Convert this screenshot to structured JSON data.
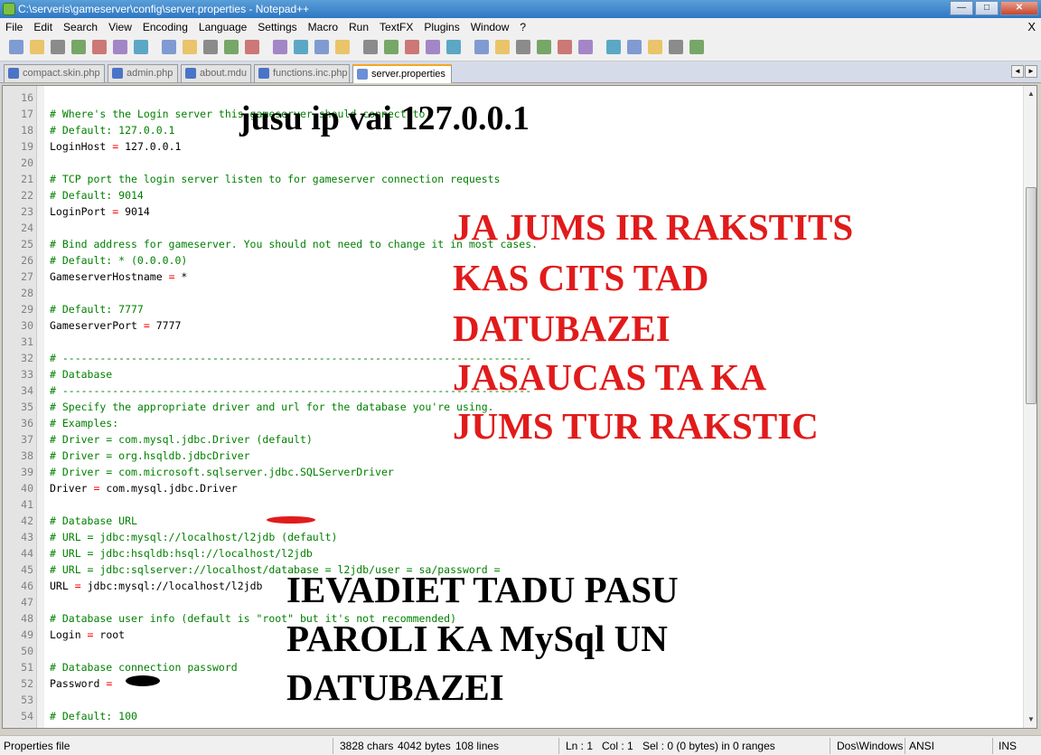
{
  "window": {
    "title": "C:\\serveris\\gameserver\\config\\server.properties - Notepad++"
  },
  "menu": [
    "File",
    "Edit",
    "Search",
    "View",
    "Encoding",
    "Language",
    "Settings",
    "Macro",
    "Run",
    "TextFX",
    "Plugins",
    "Window",
    "?"
  ],
  "menu_close": "X",
  "tabs": [
    {
      "label": "compact.skin.php",
      "active": false
    },
    {
      "label": "admin.php",
      "active": false
    },
    {
      "label": "about.mdu",
      "active": false
    },
    {
      "label": "functions.inc.php",
      "active": false
    },
    {
      "label": "server.properties",
      "active": true
    }
  ],
  "toolbar_icons": [
    "new-icon",
    "open-icon",
    "save-icon",
    "save-all-icon",
    "close-icon",
    "close-all-icon",
    "print-icon",
    "cut-icon",
    "copy-icon",
    "paste-icon",
    "undo-icon",
    "redo-icon",
    "find-icon",
    "replace-icon",
    "zoom-in-icon",
    "zoom-out-icon",
    "sync-v-icon",
    "sync-h-icon",
    "wrap-icon",
    "show-all-icon",
    "indent-guide-icon",
    "record-icon",
    "stop-icon",
    "play-icon",
    "play-multi-icon",
    "save-macro-icon",
    "trim-icon",
    "up-icon",
    "down-icon",
    "sort-icon",
    "folder-icon",
    "spell-icon"
  ],
  "lines": [
    {
      "n": "16",
      "t": "",
      "c": false
    },
    {
      "n": "17",
      "t": "# Where's the Login server this gameserver should connect to",
      "c": true
    },
    {
      "n": "18",
      "t": "# Default: 127.0.0.1",
      "c": true
    },
    {
      "n": "19",
      "t": "LoginHost = 127.0.0.1",
      "c": false
    },
    {
      "n": "20",
      "t": "",
      "c": false
    },
    {
      "n": "21",
      "t": "# TCP port the login server listen to for gameserver connection requests",
      "c": true
    },
    {
      "n": "22",
      "t": "# Default: 9014",
      "c": true
    },
    {
      "n": "23",
      "t": "LoginPort = 9014",
      "c": false
    },
    {
      "n": "24",
      "t": "",
      "c": false
    },
    {
      "n": "25",
      "t": "# Bind address for gameserver. You should not need to change it in most cases.",
      "c": true
    },
    {
      "n": "26",
      "t": "# Default: * (0.0.0.0)",
      "c": true
    },
    {
      "n": "27",
      "t": "GameserverHostname = *",
      "c": false
    },
    {
      "n": "28",
      "t": "",
      "c": false
    },
    {
      "n": "29",
      "t": "# Default: 7777",
      "c": true
    },
    {
      "n": "30",
      "t": "GameserverPort = 7777",
      "c": false
    },
    {
      "n": "31",
      "t": "",
      "c": false
    },
    {
      "n": "32",
      "t": "# ---------------------------------------------------------------------------",
      "c": true
    },
    {
      "n": "33",
      "t": "# Database",
      "c": true
    },
    {
      "n": "34",
      "t": "# ---------------------------------------------------------------------------",
      "c": true
    },
    {
      "n": "35",
      "t": "# Specify the appropriate driver and url for the database you're using.",
      "c": true
    },
    {
      "n": "36",
      "t": "# Examples:",
      "c": true
    },
    {
      "n": "37",
      "t": "# Driver = com.mysql.jdbc.Driver (default)",
      "c": true
    },
    {
      "n": "38",
      "t": "# Driver = org.hsqldb.jdbcDriver",
      "c": true
    },
    {
      "n": "39",
      "t": "# Driver = com.microsoft.sqlserver.jdbc.SQLServerDriver",
      "c": true
    },
    {
      "n": "40",
      "t": "Driver = com.mysql.jdbc.Driver",
      "c": false
    },
    {
      "n": "41",
      "t": "",
      "c": false
    },
    {
      "n": "42",
      "t": "# Database URL",
      "c": true
    },
    {
      "n": "43",
      "t": "# URL = jdbc:mysql://localhost/l2jdb (default)",
      "c": true
    },
    {
      "n": "44",
      "t": "# URL = jdbc:hsqldb:hsql://localhost/l2jdb",
      "c": true
    },
    {
      "n": "45",
      "t": "# URL = jdbc:sqlserver://localhost/database = l2jdb/user = sa/password =",
      "c": true
    },
    {
      "n": "46",
      "t": "URL = jdbc:mysql://localhost/l2jdb",
      "c": false
    },
    {
      "n": "47",
      "t": "",
      "c": false
    },
    {
      "n": "48",
      "t": "# Database user info (default is \"root\" but it's not recommended)",
      "c": true
    },
    {
      "n": "49",
      "t": "Login = root",
      "c": false
    },
    {
      "n": "50",
      "t": "",
      "c": false
    },
    {
      "n": "51",
      "t": "# Database connection password",
      "c": true
    },
    {
      "n": "52",
      "t": "Password = ",
      "c": false
    },
    {
      "n": "53",
      "t": "",
      "c": false
    },
    {
      "n": "54",
      "t": "# Default: 100",
      "c": true
    }
  ],
  "annotations": {
    "ip_note": "jusu ip vai 127.0.0.1",
    "red_note": [
      "JA JUMS IR RAKSTITS",
      "KAS CITS TAD",
      "DATUBAZEI",
      "JASAUCAS TA KA",
      "JUMS TUR RAKSTIC"
    ],
    "password_note": [
      "IEVADIET TADU PASU",
      "PAROLI KA MySql UN",
      "DATUBAZEI"
    ]
  },
  "status": {
    "filetype": "Properties file",
    "chars": "3828 chars",
    "bytes": "4042 bytes",
    "lines": "108 lines",
    "ln": "Ln : 1",
    "col": "Col : 1",
    "sel": "Sel : 0 (0 bytes) in 0 ranges",
    "eol": "Dos\\Windows",
    "encoding": "ANSI",
    "mode": "INS"
  },
  "colors": {
    "comment": "#008000",
    "operator": "#ff0000",
    "annotation_red": "#e11b1b",
    "active_tab_accent": "#f5a623"
  }
}
